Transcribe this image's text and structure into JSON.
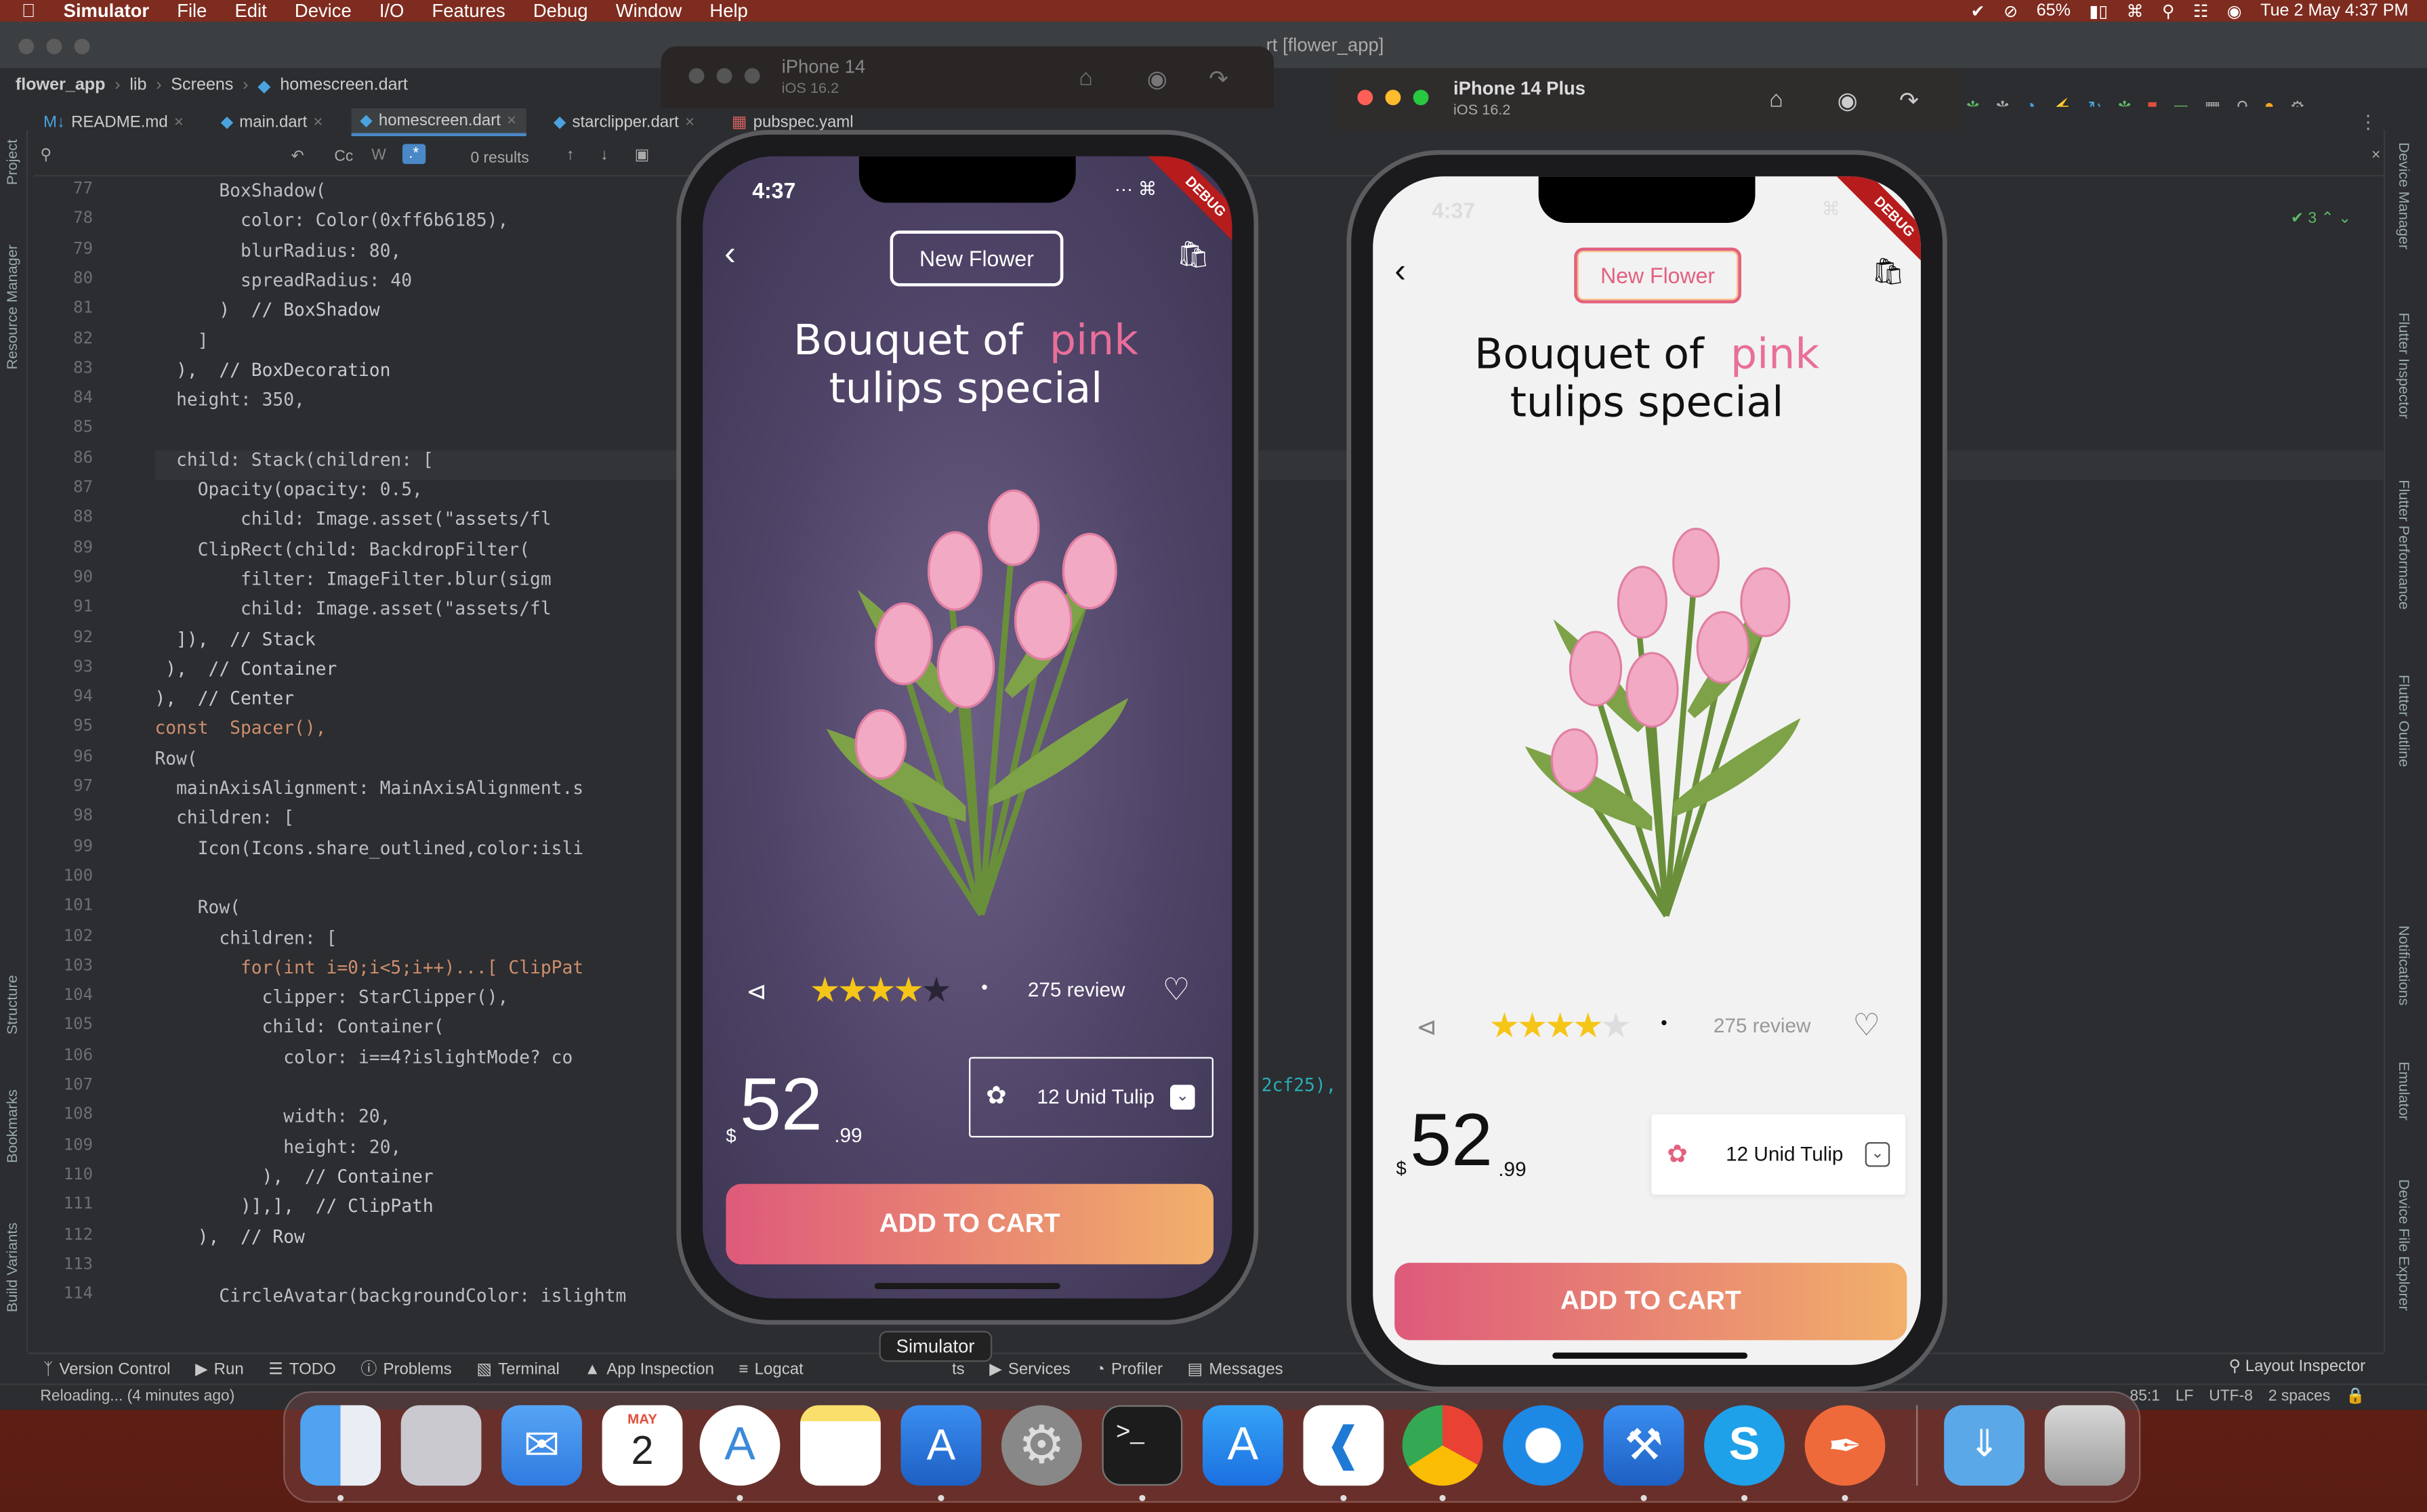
{
  "menubar": {
    "app": "Simulator",
    "items": [
      "File",
      "Edit",
      "Device",
      "I/O",
      "Features",
      "Debug",
      "Window",
      "Help"
    ],
    "battery": "65%",
    "datetime": "Tue 2 May  4:37 PM"
  },
  "ide": {
    "title_fragment": "rt [flower_app]",
    "breadcrumbs": [
      "flower_app",
      "lib",
      "Screens",
      "homescreen.dart"
    ],
    "tabs": [
      "README.md",
      "main.dart",
      "homescreen.dart",
      "starclipper.dart",
      "pubspec.yaml"
    ],
    "active_tab": "homescreen.dart",
    "find_case": "Cc",
    "find_regex": ".*",
    "find_results": "0 results",
    "inspections": "3",
    "left_tools": [
      "Project",
      "Resource Manager",
      "Structure",
      "Bookmarks",
      "Build Variants"
    ],
    "right_tools": [
      "Device Manager",
      "Flutter Inspector",
      "Flutter Performance",
      "Flutter Outline",
      "Notifications",
      "Emulator",
      "Device File Explorer"
    ],
    "line_numbers": [
      "77",
      "78",
      "79",
      "80",
      "81",
      "82",
      "83",
      "84",
      "85",
      "86",
      "87",
      "88",
      "89",
      "90",
      "91",
      "92",
      "93",
      "94",
      "95",
      "96",
      "97",
      "98",
      "99",
      "100",
      "101",
      "102",
      "103",
      "104",
      "105",
      "106",
      "107",
      "108",
      "109",
      "110",
      "111",
      "112",
      "113",
      "114"
    ],
    "code_lines": [
      "      BoxShadow(",
      "        color: Color(0xff6b6185),",
      "        blurRadius: 80,",
      "        spreadRadius: 40",
      "      )  // BoxShadow",
      "    ]",
      "  ),  // BoxDecoration",
      "  height: 350,",
      "",
      "  child: Stack(children: [",
      "    Opacity(opacity: 0.5,",
      "        child: Image.asset(\"assets/fl",
      "    ClipRect(child: BackdropFilter(",
      "        filter: ImageFilter.blur(sigm",
      "        child: Image.asset(\"assets/fl",
      "  ]),  // Stack",
      " ),  // Container",
      "),  // Center",
      "const  Spacer(),",
      "Row(",
      "  mainAxisAlignment: MainAxisAlignment.s",
      "  children: [",
      "    Icon(Icons.share_outlined,color:isli",
      "",
      "    Row(",
      "      children: [",
      "        for(int i=0;i<5;i++)...[ ClipPat",
      "          clipper: StarClipper(),",
      "          child: Container(",
      "            color: i==4?islightMode? co",
      "",
      "            width: 20,",
      "            height: 20,",
      "          ),  // Container",
      "        )],],  // ClipPath",
      "    ),  // Row",
      "",
      "      CircleAvatar(backgroundColor: islightm"
    ],
    "code_overflow": "2cf25),",
    "bottom_tools": [
      "Version Control",
      "Run",
      "TODO",
      "Problems",
      "Terminal",
      "App Inspection",
      "Logcat",
      "Services",
      "Profiler",
      "Messages"
    ],
    "bottom_partial": "ts",
    "layout_inspector": "Layout Inspector",
    "tooltip": "Simulator",
    "status_left": "Reloading... (4 minutes ago)",
    "status_right": [
      "85:1",
      "LF",
      "UTF-8",
      "2 spaces"
    ]
  },
  "sim1": {
    "device": "iPhone 14",
    "os": "iOS 16.2",
    "time": "4:37",
    "debug": "DEBUG",
    "pill": "New Flower",
    "headline1": "Bouquet of",
    "headline_pink": "pink",
    "headline2": "tulips special",
    "reviews": "275 review",
    "rating": 4,
    "price_symbol": "$",
    "price_int": "52",
    "price_dec": ".99",
    "dropdown": "12 Unid Tulip",
    "cta": "ADD TO CART",
    "colors": {
      "bg": "#4d4263",
      "pill_border": "#ffffff",
      "text": "#ffffff",
      "star": "#f5c518",
      "star_off": "#2a2438"
    }
  },
  "sim2": {
    "device": "iPhone 14 Plus",
    "os": "iOS 16.2",
    "time": "4:37",
    "debug": "DEBUG",
    "pill": "New Flower",
    "headline1": "Bouquet of",
    "headline_pink": "pink",
    "headline2": "tulips special",
    "reviews": "275 review",
    "rating": 4,
    "price_symbol": "$",
    "price_int": "52",
    "price_dec": ".99",
    "dropdown": "12 Unid Tulip",
    "cta": "ADD TO CART",
    "colors": {
      "bg": "#f2f2f2",
      "pill_border": "#e3607f",
      "text": "#111111",
      "star": "#f5c518",
      "star_off": "#dddddd"
    }
  },
  "dock": {
    "calendar_month": "MAY",
    "calendar_day": "2",
    "terminal_prompt": ">_",
    "apps": [
      "Finder",
      "Launchpad",
      "Mail",
      "Calendar",
      "Android Studio",
      "Notes",
      "Simulator",
      "System Settings",
      "Terminal",
      "App Store",
      "VS Code",
      "Chrome",
      "Safari",
      "Xcode",
      "Skype",
      "Paw",
      "Downloads",
      "Trash"
    ]
  }
}
